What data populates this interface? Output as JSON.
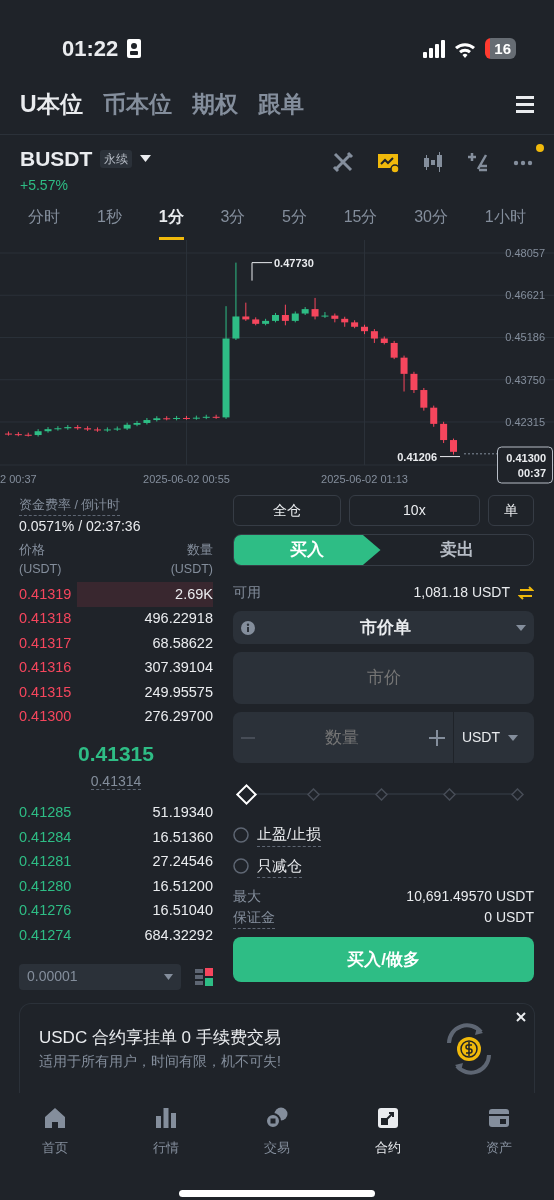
{
  "status_bar": {
    "time": "01:22",
    "battery": "16"
  },
  "market_tabs": [
    {
      "label": "U本位",
      "selected": true
    },
    {
      "label": "币本位",
      "selected": false
    },
    {
      "label": "期权",
      "selected": false
    },
    {
      "label": "跟单",
      "selected": false
    }
  ],
  "symbol": {
    "name": "BUSDT",
    "badge": "永续",
    "change": "+5.57%"
  },
  "tools": [
    {
      "kind": "swords",
      "selected": false
    },
    {
      "kind": "chart",
      "selected": true
    },
    {
      "kind": "candles",
      "selected": false
    },
    {
      "kind": "calculator",
      "selected": false
    },
    {
      "kind": "more",
      "selected": false,
      "notification": true
    }
  ],
  "intervals": [
    {
      "label": "分时",
      "selected": false
    },
    {
      "label": "1秒",
      "selected": false
    },
    {
      "label": "1分",
      "selected": true
    },
    {
      "label": "3分",
      "selected": false
    },
    {
      "label": "5分",
      "selected": false
    },
    {
      "label": "15分",
      "selected": false
    },
    {
      "label": "30分",
      "selected": false
    },
    {
      "label": "1小时",
      "selected": false
    }
  ],
  "chart": {
    "chart_data": {
      "type": "candlestick",
      "categories": [
        null,
        "2 00:37",
        null,
        null,
        null,
        null,
        null,
        null,
        null,
        null,
        null,
        null,
        null,
        null,
        null,
        null,
        null,
        null,
        "2025-06-02 00:55",
        null,
        null,
        null,
        null,
        null,
        null,
        null,
        null,
        null,
        null,
        null,
        null,
        null,
        null,
        null,
        null,
        null,
        "2025-06-02 01:13",
        null,
        null,
        null,
        null,
        null,
        null,
        null,
        null,
        null
      ],
      "ylim": [
        0.40852,
        0.48499
      ],
      "grid": true,
      "ohlc": [
        [
          0.4192,
          0.4199,
          0.4185,
          0.419
        ],
        [
          0.419,
          0.4197,
          0.4183,
          0.4188
        ],
        [
          0.4188,
          0.4195,
          0.4182,
          0.4187
        ],
        [
          0.4187,
          0.4207,
          0.4182,
          0.42
        ],
        [
          0.42,
          0.4214,
          0.4195,
          0.4207
        ],
        [
          0.4207,
          0.4217,
          0.4202,
          0.421
        ],
        [
          0.421,
          0.4221,
          0.4205,
          0.4214
        ],
        [
          0.4214,
          0.4221,
          0.4205,
          0.421
        ],
        [
          0.421,
          0.4217,
          0.4201,
          0.4206
        ],
        [
          0.4206,
          0.4213,
          0.4198,
          0.4203
        ],
        [
          0.4203,
          0.4213,
          0.4198,
          0.4206
        ],
        [
          0.4206,
          0.4216,
          0.4201,
          0.4209
        ],
        [
          0.4209,
          0.4229,
          0.4204,
          0.4222
        ],
        [
          0.4222,
          0.4235,
          0.4217,
          0.4228
        ],
        [
          0.4228,
          0.4245,
          0.4223,
          0.4238
        ],
        [
          0.4238,
          0.4251,
          0.4233,
          0.4244
        ],
        [
          0.4244,
          0.4251,
          0.4237,
          0.4242
        ],
        [
          0.4242,
          0.4252,
          0.4237,
          0.4245
        ],
        [
          0.4245,
          0.4252,
          0.4239,
          0.4244
        ],
        [
          0.4244,
          0.4253,
          0.4239,
          0.4246
        ],
        [
          0.4246,
          0.4256,
          0.4241,
          0.4249
        ],
        [
          0.4249,
          0.4256,
          0.4242,
          0.4247
        ],
        [
          0.4247,
          0.4625,
          0.4242,
          0.4515
        ],
        [
          0.4515,
          0.4773,
          0.451,
          0.459
        ],
        [
          0.459,
          0.4637,
          0.4575,
          0.458
        ],
        [
          0.458,
          0.4587,
          0.456,
          0.4565
        ],
        [
          0.4565,
          0.4582,
          0.456,
          0.4575
        ],
        [
          0.4575,
          0.4602,
          0.457,
          0.4595
        ],
        [
          0.4595,
          0.463,
          0.456,
          0.4575
        ],
        [
          0.4575,
          0.4607,
          0.457,
          0.46
        ],
        [
          0.46,
          0.4622,
          0.4595,
          0.4615
        ],
        [
          0.4615,
          0.4653,
          0.458,
          0.459
        ],
        [
          0.459,
          0.4605,
          0.4585,
          0.4593
        ],
        [
          0.4593,
          0.46,
          0.457,
          0.4582
        ],
        [
          0.4582,
          0.4589,
          0.4555,
          0.457
        ],
        [
          0.457,
          0.4577,
          0.455,
          0.4555
        ],
        [
          0.4555,
          0.4562,
          0.453,
          0.454
        ],
        [
          0.454,
          0.4547,
          0.45,
          0.4515
        ],
        [
          0.4515,
          0.4522,
          0.4495,
          0.45
        ],
        [
          0.45,
          0.4507,
          0.4445,
          0.445
        ],
        [
          0.445,
          0.4457,
          0.4335,
          0.4395
        ],
        [
          0.4395,
          0.4402,
          0.433,
          0.434
        ],
        [
          0.434,
          0.4347,
          0.427,
          0.428
        ],
        [
          0.428,
          0.4287,
          0.4215,
          0.4225
        ],
        [
          0.4225,
          0.4232,
          0.416,
          0.417
        ],
        [
          0.417,
          0.4175,
          0.41206,
          0.413
        ]
      ],
      "yticks": [
        {
          "value": 0.48057,
          "label": "0.48057"
        },
        {
          "value": 0.46621,
          "label": "0.46621"
        },
        {
          "value": 0.45186,
          "label": "0.45186"
        },
        {
          "value": 0.4375,
          "label": "0.43750"
        },
        {
          "value": 0.42315,
          "label": "0.42315"
        }
      ]
    },
    "high_label": "0.47730",
    "low_label": "0.41206",
    "last_price": "0.41300",
    "countdown": "00:37"
  },
  "funding": {
    "label": "资金费率 / 倒计时",
    "value": "0.0571% / 02:37:36"
  },
  "order_book": {
    "columns": [
      {
        "label": "价格",
        "unit": "(USDT)"
      },
      {
        "label": "数量",
        "unit": "(USDT)"
      }
    ],
    "asks": [
      {
        "price": "0.41319",
        "amount": "2.69K"
      },
      {
        "price": "0.41318",
        "amount": "496.22918"
      },
      {
        "price": "0.41317",
        "amount": "68.58622"
      },
      {
        "price": "0.41316",
        "amount": "307.39104"
      },
      {
        "price": "0.41315",
        "amount": "249.95575"
      },
      {
        "price": "0.41300",
        "amount": "276.29700"
      }
    ],
    "last_price": "0.41315",
    "mark_price": "0.41314",
    "bids": [
      {
        "price": "0.41285",
        "amount": "51.19340"
      },
      {
        "price": "0.41284",
        "amount": "16.51360"
      },
      {
        "price": "0.41281",
        "amount": "27.24546"
      },
      {
        "price": "0.41280",
        "amount": "16.51200"
      },
      {
        "price": "0.41276",
        "amount": "16.51040"
      },
      {
        "price": "0.41274",
        "amount": "684.32292"
      }
    ],
    "precision": "0.00001"
  },
  "order_form": {
    "margin_mode": "全仓",
    "leverage": "10x",
    "position_mode": "单",
    "sides": [
      {
        "label": "买入",
        "selected": true
      },
      {
        "label": "卖出",
        "selected": false
      }
    ],
    "available_label": "可用",
    "available": "1,081.18 USDT",
    "order_type": "市价单",
    "price_placeholder": "市价",
    "quantity_placeholder": "数量",
    "quantity_unit": "USDT",
    "slider": {
      "level": 0
    },
    "options": [
      {
        "label": "止盈/止损",
        "checked": false
      },
      {
        "label": "只减仓",
        "checked": false
      }
    ],
    "max_label": "最大",
    "max_value": "10,691.49570 USDT",
    "margin_label": "保证金",
    "margin_value": "0 USDT",
    "submit": "买入/做多"
  },
  "banner": {
    "title": "USDC 合约享挂单 0 手续费交易",
    "subtitle": "适用于所有用户，时间有限，机不可失!"
  },
  "bottom_nav": [
    {
      "label": "首页",
      "kind": "home",
      "selected": false
    },
    {
      "label": "行情",
      "kind": "markets",
      "selected": false
    },
    {
      "label": "交易",
      "kind": "trade",
      "selected": false
    },
    {
      "label": "合约",
      "kind": "futures",
      "selected": true
    },
    {
      "label": "资产",
      "kind": "wallet",
      "selected": false
    }
  ]
}
